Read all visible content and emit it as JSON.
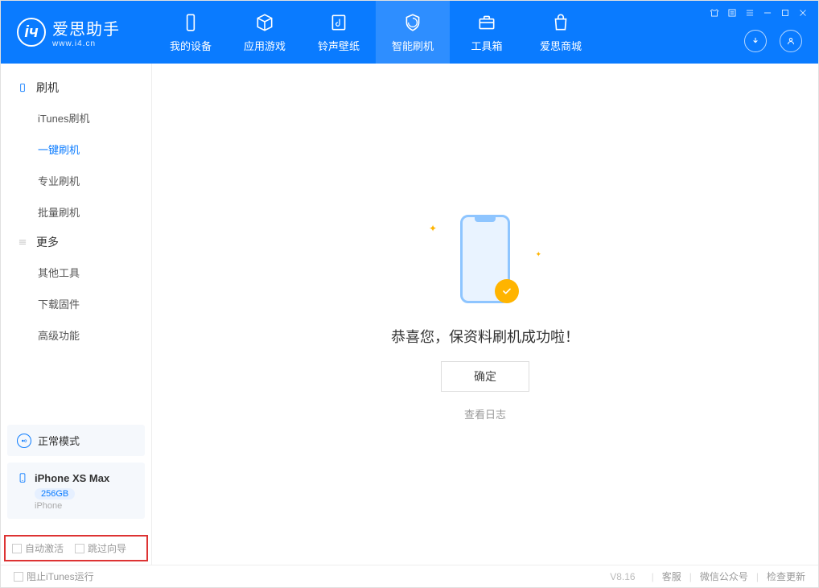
{
  "app": {
    "title": "爱思助手",
    "subtitle": "www.i4.cn"
  },
  "nav": {
    "tabs": [
      {
        "label": "我的设备"
      },
      {
        "label": "应用游戏"
      },
      {
        "label": "铃声壁纸"
      },
      {
        "label": "智能刷机"
      },
      {
        "label": "工具箱"
      },
      {
        "label": "爱思商城"
      }
    ]
  },
  "sidebar": {
    "groups": [
      {
        "title": "刷机",
        "items": [
          {
            "label": "iTunes刷机"
          },
          {
            "label": "一键刷机"
          },
          {
            "label": "专业刷机"
          },
          {
            "label": "批量刷机"
          }
        ]
      },
      {
        "title": "更多",
        "items": [
          {
            "label": "其他工具"
          },
          {
            "label": "下载固件"
          },
          {
            "label": "高级功能"
          }
        ]
      }
    ],
    "mode": "正常模式",
    "device": {
      "name": "iPhone XS Max",
      "capacity": "256GB",
      "type": "iPhone"
    },
    "checks": {
      "auto_activate": "自动激活",
      "skip_guide": "跳过向导"
    }
  },
  "main": {
    "success_message": "恭喜您，保资料刷机成功啦！",
    "ok_button": "确定",
    "view_log": "查看日志"
  },
  "footer": {
    "block_itunes": "阻止iTunes运行",
    "version": "V8.16",
    "customer_service": "客服",
    "wechat": "微信公众号",
    "check_update": "检查更新"
  }
}
